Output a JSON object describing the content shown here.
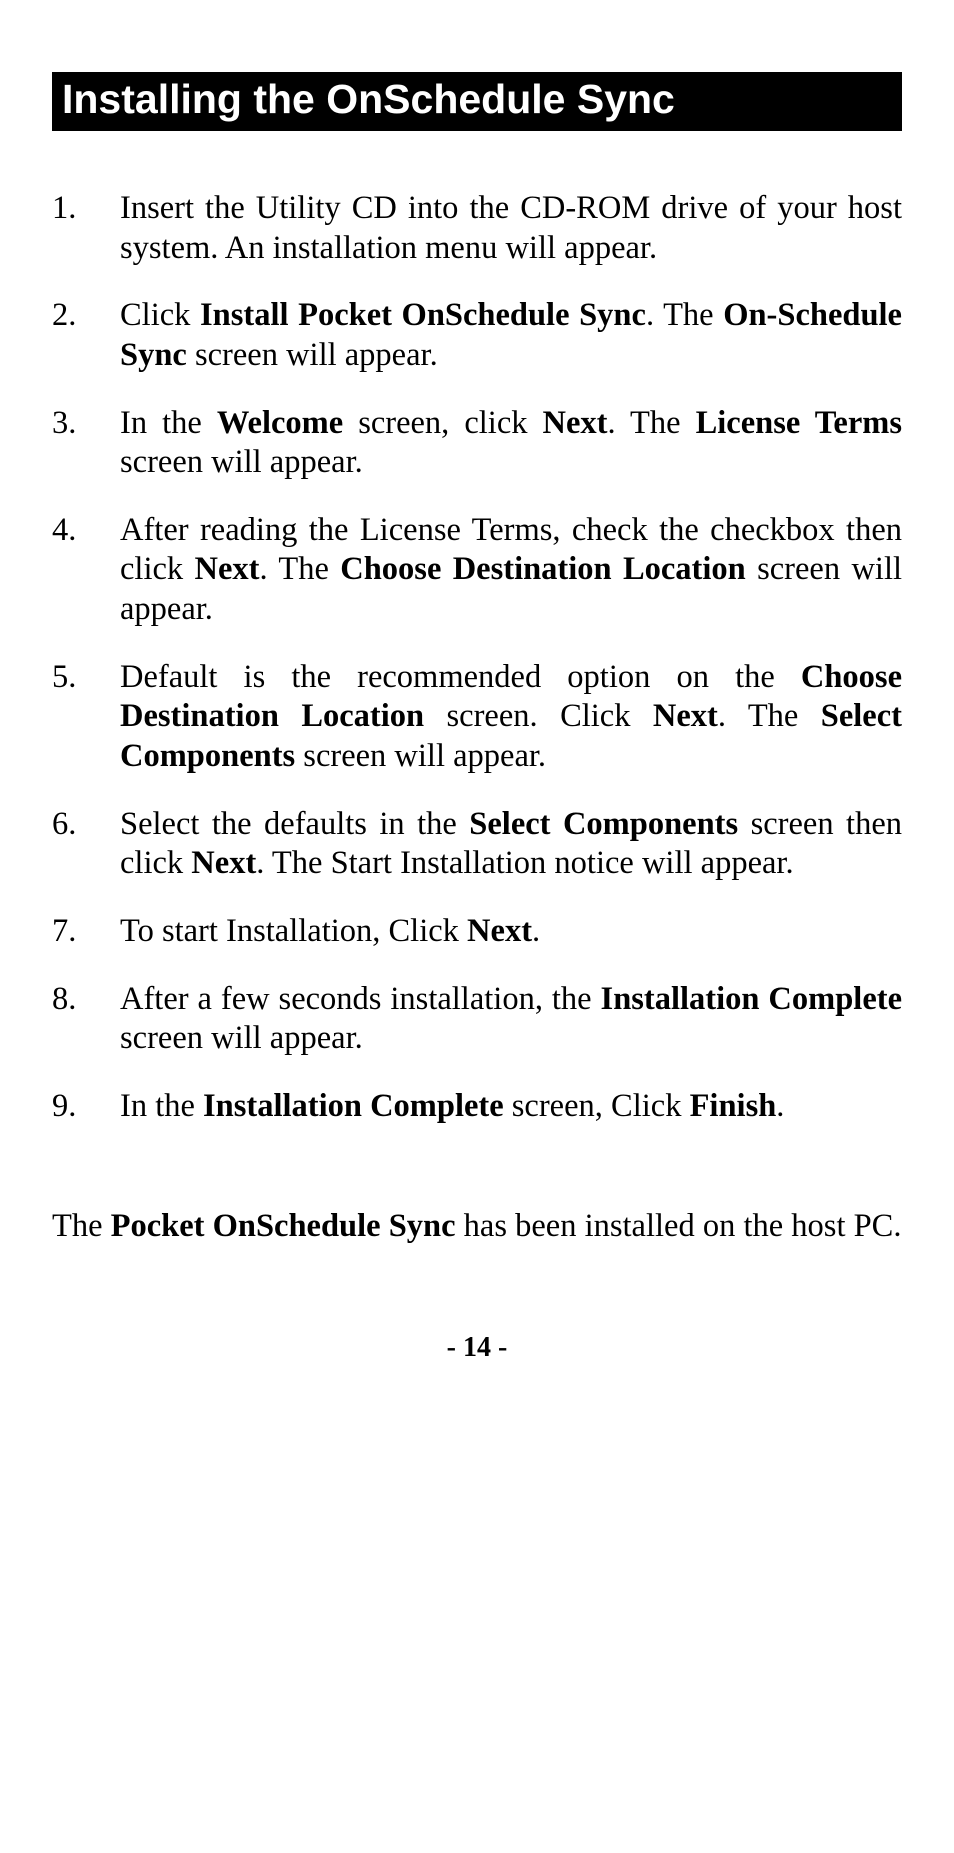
{
  "title": "Installing the OnSchedule Sync",
  "steps": [
    {
      "num": "1.",
      "segments": [
        {
          "t": "Insert the Utility CD into the CD-ROM drive of your host system. An installation menu will appear.",
          "b": false
        }
      ]
    },
    {
      "num": "2.",
      "segments": [
        {
          "t": "Click ",
          "b": false
        },
        {
          "t": "Install Pocket OnSchedule Sync",
          "b": true
        },
        {
          "t": ". The ",
          "b": false
        },
        {
          "t": "On-Schedule Sync",
          "b": true
        },
        {
          "t": " screen will appear.",
          "b": false
        }
      ]
    },
    {
      "num": "3.",
      "segments": [
        {
          "t": "In the ",
          "b": false
        },
        {
          "t": "Welcome",
          "b": true
        },
        {
          "t": " screen, click ",
          "b": false
        },
        {
          "t": "Next",
          "b": true
        },
        {
          "t": ". The ",
          "b": false
        },
        {
          "t": "License Terms",
          "b": true
        },
        {
          "t": " screen will appear.",
          "b": false
        }
      ]
    },
    {
      "num": "4.",
      "segments": [
        {
          "t": "After reading the License Terms, check the checkbox then click ",
          "b": false
        },
        {
          "t": "Next",
          "b": true
        },
        {
          "t": ". The ",
          "b": false
        },
        {
          "t": "Choose Destination Location",
          "b": true
        },
        {
          "t": " screen will appear.",
          "b": false
        }
      ]
    },
    {
      "num": "5.",
      "segments": [
        {
          "t": "Default is the recommended option on the ",
          "b": false
        },
        {
          "t": "Choose Destination Location",
          "b": true
        },
        {
          "t": " screen. Click ",
          "b": false
        },
        {
          "t": "Next",
          "b": true
        },
        {
          "t": ". The ",
          "b": false
        },
        {
          "t": "Select Components",
          "b": true
        },
        {
          "t": " screen will appear.",
          "b": false
        }
      ]
    },
    {
      "num": "6.",
      "segments": [
        {
          "t": "Select the defaults in the ",
          "b": false
        },
        {
          "t": "Select Components",
          "b": true
        },
        {
          "t": " screen then click ",
          "b": false
        },
        {
          "t": "Next",
          "b": true
        },
        {
          "t": ". The Start Installation notice will appear.",
          "b": false
        }
      ]
    },
    {
      "num": "7.",
      "segments": [
        {
          "t": "To start Installation, Click ",
          "b": false
        },
        {
          "t": "Next",
          "b": true
        },
        {
          "t": ".",
          "b": false
        }
      ]
    },
    {
      "num": "8.",
      "segments": [
        {
          "t": "After a few seconds installation, the ",
          "b": false
        },
        {
          "t": "Installation Complete",
          "b": true
        },
        {
          "t": " screen will appear.",
          "b": false
        }
      ]
    },
    {
      "num": "9.",
      "segments": [
        {
          "t": "In the ",
          "b": false
        },
        {
          "t": "Installation Complete",
          "b": true
        },
        {
          "t": " screen, Click ",
          "b": false
        },
        {
          "t": "Finish",
          "b": true
        },
        {
          "t": ".",
          "b": false
        }
      ]
    }
  ],
  "closing": [
    {
      "t": "The ",
      "b": false
    },
    {
      "t": "Pocket OnSchedule Sync",
      "b": true
    },
    {
      "t": " has been installed on the host PC.",
      "b": false
    }
  ],
  "page_number": "- 14 -"
}
